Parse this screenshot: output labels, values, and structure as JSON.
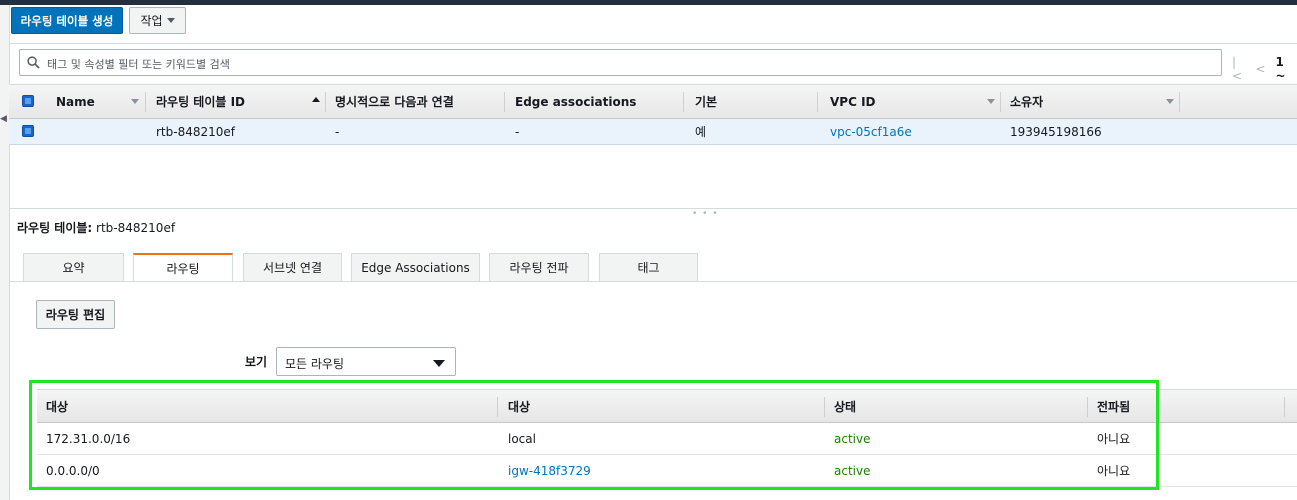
{
  "toolbar": {
    "create_button": "라우팅 테이블 생성",
    "actions_button": "작업"
  },
  "search": {
    "placeholder": "태그 및 속성별 필터 또는 키워드별 검색"
  },
  "pager": {
    "range": "1 ~"
  },
  "table": {
    "columns": [
      "Name",
      "라우팅 테이블 ID",
      "명시적으로 다음과 연결",
      "Edge associations",
      "기본",
      "VPC ID",
      "소유자"
    ],
    "rows": [
      {
        "name": "",
        "route_table_id": "rtb-848210ef",
        "explicit_associations": "-",
        "edge_associations": "-",
        "main": "예",
        "vpc_id": "vpc-05cf1a6e",
        "owner": "193945198166"
      }
    ]
  },
  "detail": {
    "label": "라우팅 테이블:",
    "value": "rtb-848210ef",
    "tabs": [
      "요약",
      "라우팅",
      "서브넷 연결",
      "Edge Associations",
      "라우팅 전파",
      "태그"
    ],
    "active_tab": "라우팅",
    "edit_button": "라우팅 편집",
    "view_label": "보기",
    "view_selected": "모든 라우팅"
  },
  "routes": {
    "columns": [
      "대상",
      "대상",
      "상태",
      "전파됨"
    ],
    "rows": [
      {
        "destination": "172.31.0.0/16",
        "target": "local",
        "status": "active",
        "propagated": "아니요"
      },
      {
        "destination": "0.0.0.0/0",
        "target": "igw-418f3729",
        "status": "active",
        "propagated": "아니요"
      }
    ]
  },
  "colors": {
    "primary": "#0073bb",
    "link": "#0073bb",
    "active_status": "#1d8102",
    "highlight": "#1fe61f",
    "tab_accent": "#ec7211"
  }
}
